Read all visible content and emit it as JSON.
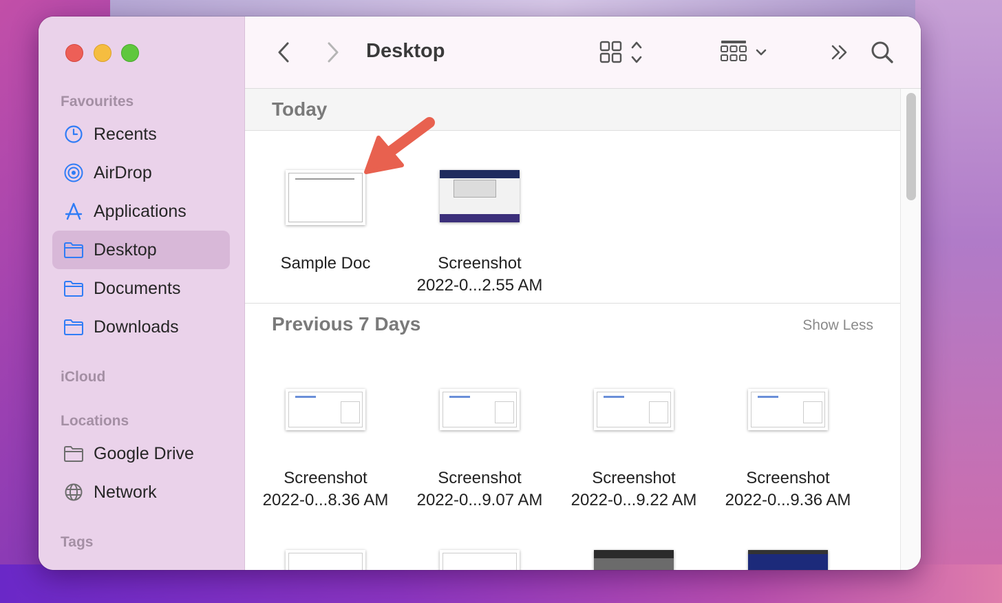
{
  "window": {
    "title": "Desktop"
  },
  "sidebar": {
    "sections": {
      "favourites": "Favourites",
      "icloud": "iCloud",
      "locations": "Locations",
      "tags": "Tags"
    },
    "favourites": [
      {
        "label": "Recents",
        "icon": "clock-icon",
        "selected": false
      },
      {
        "label": "AirDrop",
        "icon": "airdrop-icon",
        "selected": false
      },
      {
        "label": "Applications",
        "icon": "applications-icon",
        "selected": false
      },
      {
        "label": "Desktop",
        "icon": "folder-icon",
        "selected": true
      },
      {
        "label": "Documents",
        "icon": "folder-icon",
        "selected": false
      },
      {
        "label": "Downloads",
        "icon": "folder-icon",
        "selected": false
      }
    ],
    "locations": [
      {
        "label": "Google Drive",
        "icon": "drive-folder-icon"
      },
      {
        "label": "Network",
        "icon": "globe-icon"
      }
    ]
  },
  "groups": {
    "today": {
      "title": "Today",
      "files": [
        {
          "line1": "Sample Doc",
          "line2": "",
          "thumb": "document"
        },
        {
          "line1": "Screenshot",
          "line2": "2022-0...2.55 AM",
          "thumb": "screenshot-desktop"
        }
      ]
    },
    "previous": {
      "title": "Previous 7 Days",
      "action": "Show Less",
      "files": [
        {
          "line1": "Screenshot",
          "line2": "2022-0...8.36 AM",
          "thumb": "screenshot-web"
        },
        {
          "line1": "Screenshot",
          "line2": "2022-0...9.07 AM",
          "thumb": "screenshot-web"
        },
        {
          "line1": "Screenshot",
          "line2": "2022-0...9.22 AM",
          "thumb": "screenshot-web"
        },
        {
          "line1": "Screenshot",
          "line2": "2022-0...9.36 AM",
          "thumb": "screenshot-web"
        }
      ]
    }
  },
  "colors": {
    "accent": "#2f7cf6",
    "arrow": "#e8614f",
    "selected_row": "#d8b8d8"
  }
}
